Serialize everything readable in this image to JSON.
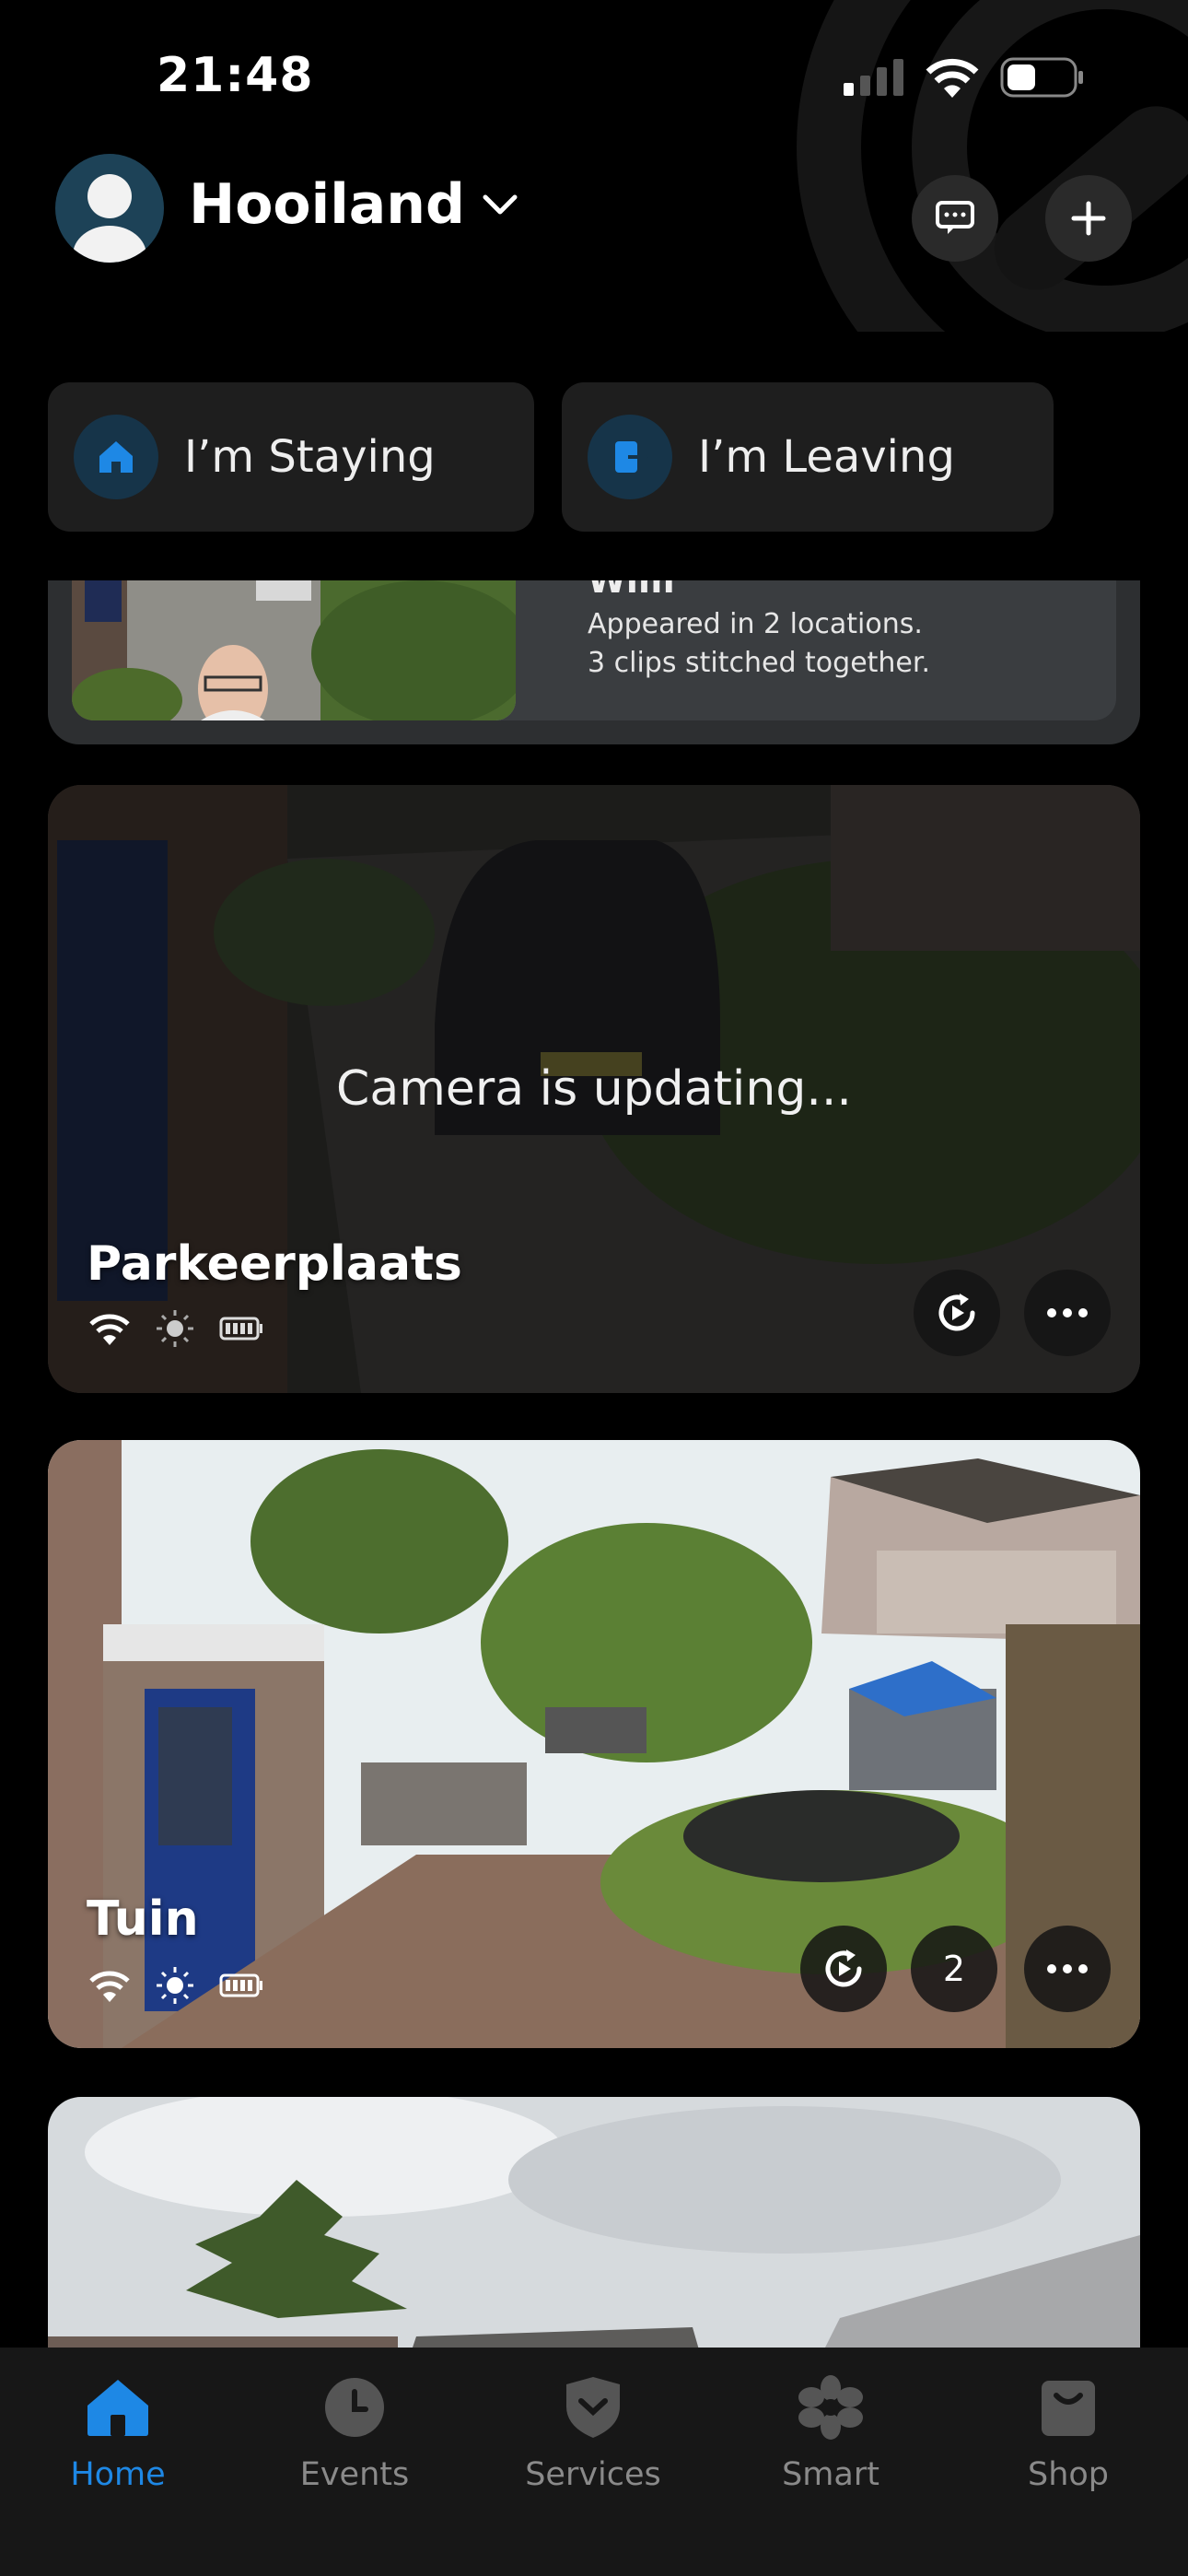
{
  "status_bar": {
    "time": "21:48"
  },
  "header": {
    "home_name": "Hooiland"
  },
  "presence": {
    "staying_label": "I’m Staying",
    "leaving_label": "I’m Leaving"
  },
  "event": {
    "name": "Wim",
    "line1": "Appeared in 2 locations.",
    "line2": "3 clips stitched together."
  },
  "cameras": [
    {
      "name": "Parkeerplaats",
      "status": "Camera is updating..."
    },
    {
      "name": "Tuin",
      "clip_count": "2"
    }
  ],
  "tabs": [
    {
      "label": "Home",
      "icon": "house-icon"
    },
    {
      "label": "Events",
      "icon": "clock-icon"
    },
    {
      "label": "Services",
      "icon": "shield-icon"
    },
    {
      "label": "Smart",
      "icon": "flower-icon"
    },
    {
      "label": "Shop",
      "icon": "bag-icon"
    }
  ],
  "colors": {
    "accent": "#1e88e5",
    "background": "#000000",
    "card": "#1e1e1e"
  }
}
